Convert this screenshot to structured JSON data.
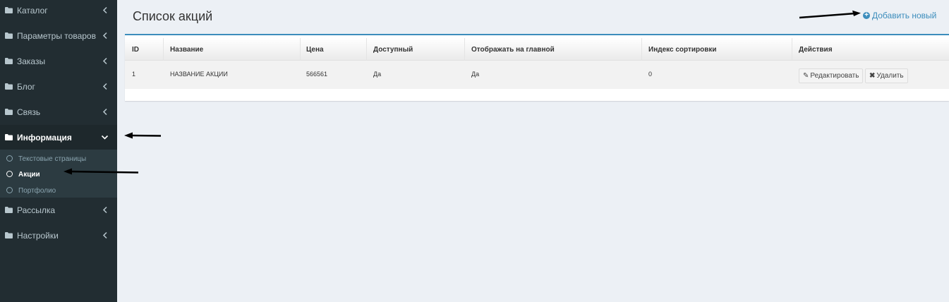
{
  "sidebar": {
    "items": [
      {
        "label": "Каталог"
      },
      {
        "label": "Параметры товаров"
      },
      {
        "label": "Заказы"
      },
      {
        "label": "Блог"
      },
      {
        "label": "Связь"
      },
      {
        "label": "Информация"
      },
      {
        "label": "Рассылка"
      },
      {
        "label": "Настройки"
      }
    ],
    "submenu": [
      {
        "label": "Текстовые страницы"
      },
      {
        "label": "Акции"
      },
      {
        "label": "Портфолио"
      }
    ]
  },
  "header": {
    "title": "Список акций",
    "add_new_label": "Добавить новый"
  },
  "table": {
    "columns": [
      "ID",
      "Название",
      "Цена",
      "Доступный",
      "Отображать на главной",
      "Индекс сортировки",
      "Действия"
    ],
    "rows": [
      {
        "id": "1",
        "name": "НАЗВАНИЕ АКЦИИ",
        "price": "566561",
        "available": "Да",
        "show_on_main": "Да",
        "sort_index": "0"
      }
    ],
    "edit_label": "Редактировать",
    "delete_label": "Удалить"
  },
  "colors": {
    "sidebar_bg": "#222d32",
    "submenu_bg": "#2c3b41",
    "accent": "#3c8dbc",
    "content_bg": "#ecf0f5"
  },
  "icons": [
    "folder-icon",
    "chevron-left-icon",
    "chevron-down-icon",
    "circle-outline-icon",
    "plus-circle-icon",
    "pencil-icon",
    "close-icon",
    "arrow-left-icon",
    "arrow-right-icon"
  ]
}
